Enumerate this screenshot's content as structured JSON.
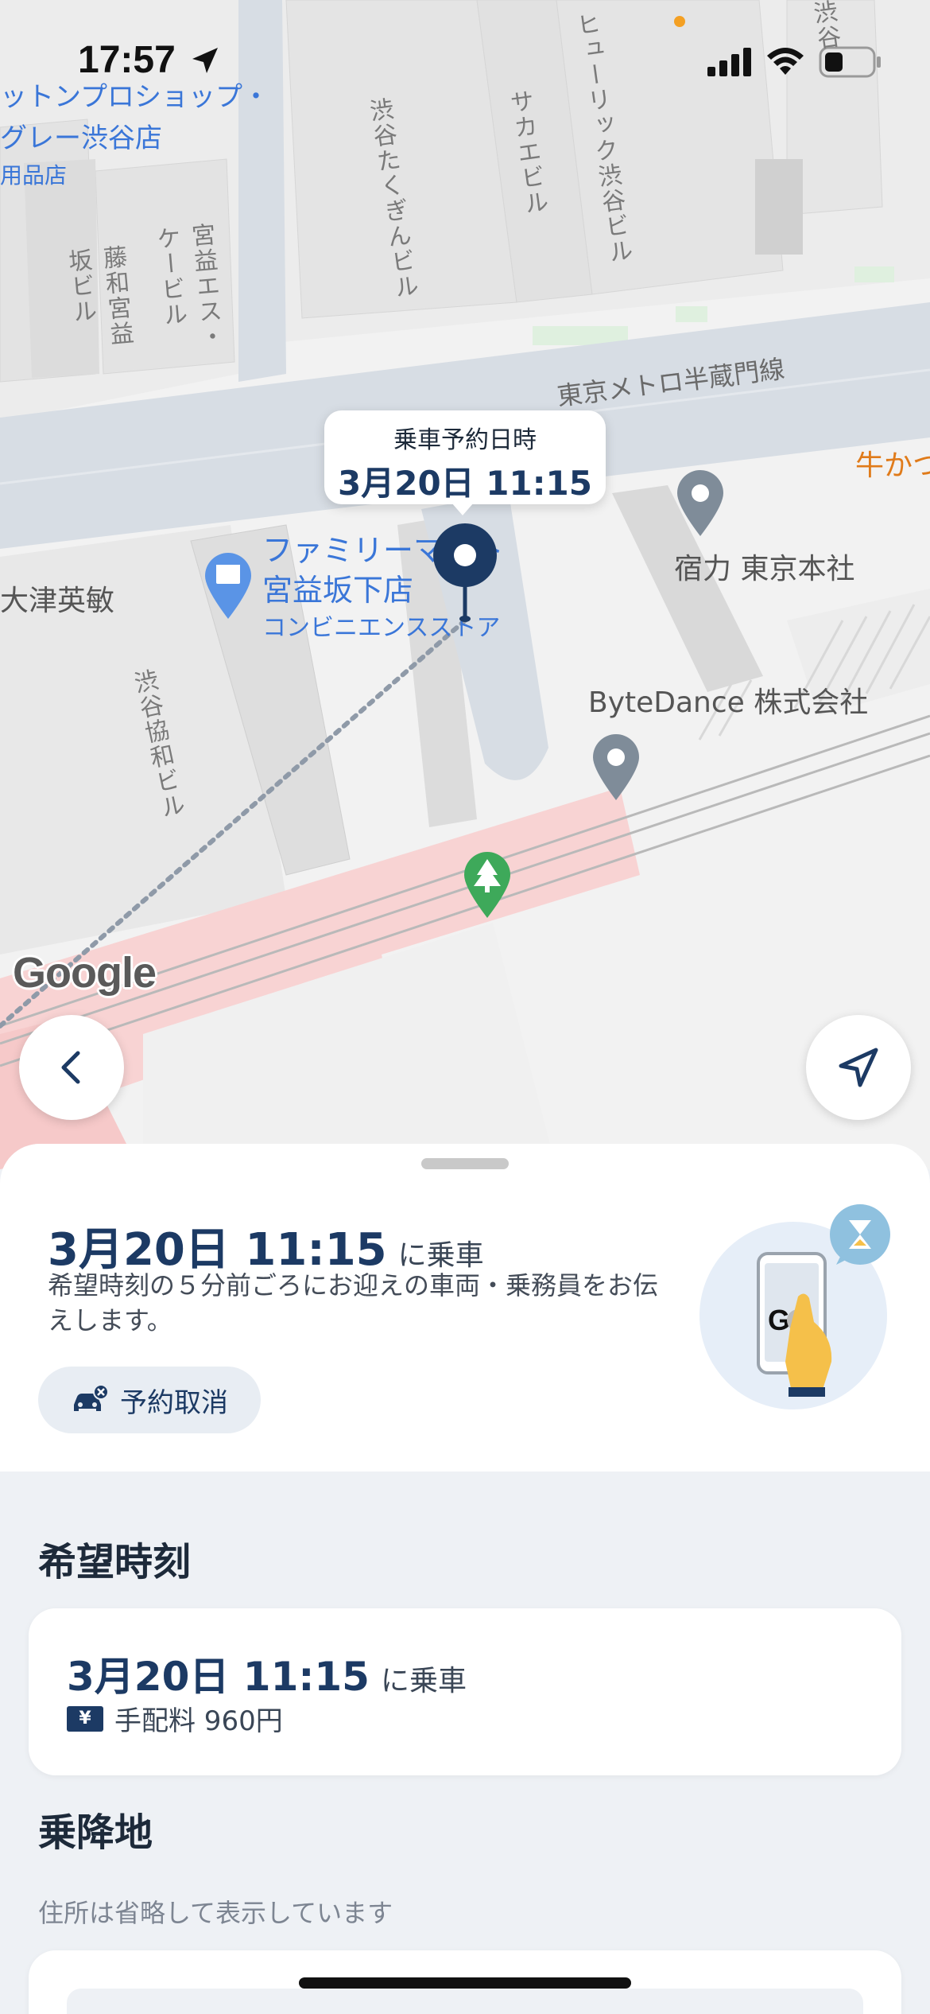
{
  "status_bar": {
    "time": "17:57"
  },
  "map": {
    "labels": {
      "shop_line1": "ットンプロショップ・",
      "shop_line2": "グレー渋谷店",
      "shop_cat": "用品店",
      "bldg_takugin": "渋谷たくぎんビル",
      "bldg_sakae": "サカエビル",
      "bldg_hulic": "ヒューリック渋谷ビル",
      "bldg_miyamasu_es": "宮益エス・ケービル",
      "bldg_fujiwa": "藤和宮益坂ビル",
      "bldg_kyowa": "渋谷協和ビル",
      "metro_line": "東京メトロ半蔵門線",
      "gyukatsu": "牛かつ",
      "familymart_name": "ファミリーマート",
      "familymart_branch": "宮益坂下店",
      "familymart_cat": "コンビニエンスストア",
      "otsu": "大津英敏",
      "shukuriki": "宿力 東京本社",
      "bytedance": "ByteDance 株式会社",
      "corner": "渋谷"
    },
    "pin_bubble": {
      "label": "乗車予約日時",
      "time": "3月20日 11:15"
    },
    "google_logo": "Google"
  },
  "sheet": {
    "pickup": {
      "datetime": "3月20日 11:15",
      "suffix": "に乗車",
      "notice": "希望時刻の５分前ごろにお迎えの車両・乗務員をお伝えします。",
      "cancel_label": "予約取消",
      "illust_letter": "G"
    },
    "desired_time": {
      "title": "希望時刻",
      "datetime": "3月20日 11:15",
      "suffix": "に乗車",
      "fee_icon": "¥",
      "fee": "手配料 960円"
    },
    "location": {
      "title": "乗降地",
      "subtitle": "住所は省略して表示しています"
    }
  }
}
